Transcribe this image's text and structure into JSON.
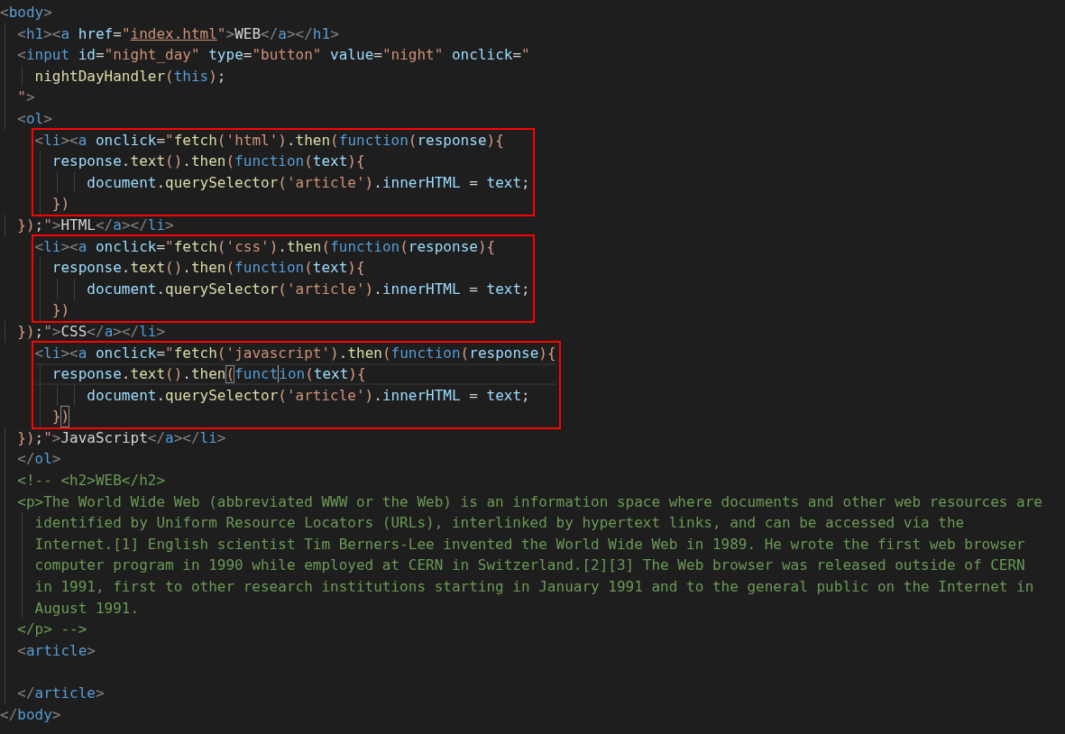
{
  "rows": [
    {
      "kind": "line",
      "current": false,
      "tokens": [
        {
          "kind": "p",
          "text": "<"
        },
        {
          "kind": "tag",
          "text": "body"
        },
        {
          "kind": "p",
          "text": ">"
        }
      ]
    },
    {
      "kind": "line",
      "current": false,
      "tokens": [
        {
          "kind": "p",
          "text": "  <"
        },
        {
          "kind": "tag",
          "text": "h1"
        },
        {
          "kind": "p",
          "text": "><"
        },
        {
          "kind": "tag",
          "text": "a"
        },
        {
          "kind": "attr",
          "text": " href"
        },
        {
          "kind": "op",
          "text": "="
        },
        {
          "kind": "str",
          "text": "\""
        },
        {
          "kind": "link",
          "text": "index.html"
        },
        {
          "kind": "str",
          "text": "\""
        },
        {
          "kind": "p",
          "text": ">"
        },
        {
          "kind": "txt",
          "text": "WEB"
        },
        {
          "kind": "p",
          "text": "</"
        },
        {
          "kind": "tag",
          "text": "a"
        },
        {
          "kind": "p",
          "text": "></"
        },
        {
          "kind": "tag",
          "text": "h1"
        },
        {
          "kind": "p",
          "text": ">"
        }
      ]
    },
    {
      "kind": "line",
      "current": false,
      "tokens": [
        {
          "kind": "p",
          "text": "  <"
        },
        {
          "kind": "tag",
          "text": "input"
        },
        {
          "kind": "attr",
          "text": " id"
        },
        {
          "kind": "op",
          "text": "="
        },
        {
          "kind": "str",
          "text": "\"night_day\""
        },
        {
          "kind": "attr",
          "text": " type"
        },
        {
          "kind": "op",
          "text": "="
        },
        {
          "kind": "str",
          "text": "\"button\""
        },
        {
          "kind": "attr",
          "text": " value"
        },
        {
          "kind": "op",
          "text": "="
        },
        {
          "kind": "str",
          "text": "\"night\""
        },
        {
          "kind": "attr",
          "text": " onclick"
        },
        {
          "kind": "op",
          "text": "="
        },
        {
          "kind": "str",
          "text": "\""
        }
      ]
    },
    {
      "kind": "line",
      "current": false,
      "tokens": [
        {
          "kind": "fn",
          "text": "    nightDayHandler"
        },
        {
          "kind": "brk",
          "text": "("
        },
        {
          "kind": "kw",
          "text": "this"
        },
        {
          "kind": "brk",
          "text": ")"
        },
        {
          "kind": "op",
          "text": ";"
        }
      ]
    },
    {
      "kind": "line",
      "current": false,
      "tokens": [
        {
          "kind": "str",
          "text": "  \""
        },
        {
          "kind": "p",
          "text": ">"
        }
      ]
    },
    {
      "kind": "line",
      "current": false,
      "tokens": [
        {
          "kind": "p",
          "text": "  <"
        },
        {
          "kind": "tag",
          "text": "ol"
        },
        {
          "kind": "p",
          "text": ">"
        }
      ]
    },
    {
      "kind": "highlight",
      "rows": [
        {
          "kind": "line",
          "current": false,
          "tokens": [
            {
              "kind": "p",
              "text": "    <"
            },
            {
              "kind": "tag",
              "text": "li"
            },
            {
              "kind": "p",
              "text": "><"
            },
            {
              "kind": "tag",
              "text": "a"
            },
            {
              "kind": "attr",
              "text": " onclick"
            },
            {
              "kind": "op",
              "text": "="
            },
            {
              "kind": "str",
              "text": "\""
            },
            {
              "kind": "fn",
              "text": "fetch"
            },
            {
              "kind": "brk",
              "text": "("
            },
            {
              "kind": "str",
              "text": "'html'"
            },
            {
              "kind": "brk",
              "text": ")"
            },
            {
              "kind": "op",
              "text": "."
            },
            {
              "kind": "fn",
              "text": "then"
            },
            {
              "kind": "brk",
              "text": "("
            },
            {
              "kind": "kw",
              "text": "function"
            },
            {
              "kind": "brk",
              "text": "("
            },
            {
              "kind": "var",
              "text": "response"
            },
            {
              "kind": "brk",
              "text": "){"
            }
          ]
        },
        {
          "kind": "line",
          "current": false,
          "tokens": [
            {
              "kind": "var",
              "text": "      response"
            },
            {
              "kind": "op",
              "text": "."
            },
            {
              "kind": "fn",
              "text": "text"
            },
            {
              "kind": "brk",
              "text": "()"
            },
            {
              "kind": "op",
              "text": "."
            },
            {
              "kind": "fn",
              "text": "then"
            },
            {
              "kind": "brk",
              "text": "("
            },
            {
              "kind": "kw",
              "text": "function"
            },
            {
              "kind": "brk",
              "text": "("
            },
            {
              "kind": "var",
              "text": "text"
            },
            {
              "kind": "brk",
              "text": "){"
            }
          ]
        },
        {
          "kind": "line",
          "current": false,
          "tokens": [
            {
              "kind": "var",
              "text": "          document"
            },
            {
              "kind": "op",
              "text": "."
            },
            {
              "kind": "fn",
              "text": "querySelector"
            },
            {
              "kind": "brk",
              "text": "("
            },
            {
              "kind": "str",
              "text": "'article'"
            },
            {
              "kind": "brk",
              "text": ")"
            },
            {
              "kind": "op",
              "text": "."
            },
            {
              "kind": "var",
              "text": "innerHTML"
            },
            {
              "kind": "op",
              "text": " = "
            },
            {
              "kind": "var",
              "text": "text"
            },
            {
              "kind": "op",
              "text": ";"
            }
          ]
        },
        {
          "kind": "line",
          "current": false,
          "tokens": [
            {
              "kind": "brk",
              "text": "      })"
            }
          ]
        }
      ]
    },
    {
      "kind": "line",
      "current": false,
      "tokens": [
        {
          "kind": "brk",
          "text": "  })"
        },
        {
          "kind": "op",
          "text": ";"
        },
        {
          "kind": "str",
          "text": "\""
        },
        {
          "kind": "p",
          "text": ">"
        },
        {
          "kind": "txt",
          "text": "HTML"
        },
        {
          "kind": "p",
          "text": "</"
        },
        {
          "kind": "tag",
          "text": "a"
        },
        {
          "kind": "p",
          "text": "></"
        },
        {
          "kind": "tag",
          "text": "li"
        },
        {
          "kind": "p",
          "text": ">"
        }
      ]
    },
    {
      "kind": "highlight",
      "rows": [
        {
          "kind": "line",
          "current": false,
          "tokens": [
            {
              "kind": "p",
              "text": "    <"
            },
            {
              "kind": "tag",
              "text": "li"
            },
            {
              "kind": "p",
              "text": "><"
            },
            {
              "kind": "tag",
              "text": "a"
            },
            {
              "kind": "attr",
              "text": " onclick"
            },
            {
              "kind": "op",
              "text": "="
            },
            {
              "kind": "str",
              "text": "\""
            },
            {
              "kind": "fn",
              "text": "fetch"
            },
            {
              "kind": "brk",
              "text": "("
            },
            {
              "kind": "str",
              "text": "'css'"
            },
            {
              "kind": "brk",
              "text": ")"
            },
            {
              "kind": "op",
              "text": "."
            },
            {
              "kind": "fn",
              "text": "then"
            },
            {
              "kind": "brk",
              "text": "("
            },
            {
              "kind": "kw",
              "text": "function"
            },
            {
              "kind": "brk",
              "text": "("
            },
            {
              "kind": "var",
              "text": "response"
            },
            {
              "kind": "brk",
              "text": "){"
            }
          ]
        },
        {
          "kind": "line",
          "current": false,
          "tokens": [
            {
              "kind": "var",
              "text": "      response"
            },
            {
              "kind": "op",
              "text": "."
            },
            {
              "kind": "fn",
              "text": "text"
            },
            {
              "kind": "brk",
              "text": "()"
            },
            {
              "kind": "op",
              "text": "."
            },
            {
              "kind": "fn",
              "text": "then"
            },
            {
              "kind": "brk",
              "text": "("
            },
            {
              "kind": "kw",
              "text": "function"
            },
            {
              "kind": "brk",
              "text": "("
            },
            {
              "kind": "var",
              "text": "text"
            },
            {
              "kind": "brk",
              "text": "){"
            }
          ]
        },
        {
          "kind": "line",
          "current": false,
          "tokens": [
            {
              "kind": "var",
              "text": "          document"
            },
            {
              "kind": "op",
              "text": "."
            },
            {
              "kind": "fn",
              "text": "querySelector"
            },
            {
              "kind": "brk",
              "text": "("
            },
            {
              "kind": "str",
              "text": "'article'"
            },
            {
              "kind": "brk",
              "text": ")"
            },
            {
              "kind": "op",
              "text": "."
            },
            {
              "kind": "var",
              "text": "innerHTML"
            },
            {
              "kind": "op",
              "text": " = "
            },
            {
              "kind": "var",
              "text": "text"
            },
            {
              "kind": "op",
              "text": ";"
            }
          ]
        },
        {
          "kind": "line",
          "current": false,
          "tokens": [
            {
              "kind": "brk",
              "text": "      })"
            }
          ]
        }
      ]
    },
    {
      "kind": "line",
      "current": false,
      "tokens": [
        {
          "kind": "brk",
          "text": "  })"
        },
        {
          "kind": "op",
          "text": ";"
        },
        {
          "kind": "str",
          "text": "\""
        },
        {
          "kind": "p",
          "text": ">"
        },
        {
          "kind": "txt",
          "text": "CSS"
        },
        {
          "kind": "p",
          "text": "</"
        },
        {
          "kind": "tag",
          "text": "a"
        },
        {
          "kind": "p",
          "text": "></"
        },
        {
          "kind": "tag",
          "text": "li"
        },
        {
          "kind": "p",
          "text": ">"
        }
      ]
    },
    {
      "kind": "highlight",
      "rows": [
        {
          "kind": "line",
          "current": false,
          "tokens": [
            {
              "kind": "p",
              "text": "    <"
            },
            {
              "kind": "tag",
              "text": "li"
            },
            {
              "kind": "p",
              "text": "><"
            },
            {
              "kind": "tag",
              "text": "a"
            },
            {
              "kind": "attr",
              "text": " onclick"
            },
            {
              "kind": "op",
              "text": "="
            },
            {
              "kind": "str",
              "text": "\""
            },
            {
              "kind": "fn",
              "text": "fetch"
            },
            {
              "kind": "brk",
              "text": "("
            },
            {
              "kind": "str",
              "text": "'javascript'"
            },
            {
              "kind": "brk",
              "text": ")"
            },
            {
              "kind": "op",
              "text": "."
            },
            {
              "kind": "fn",
              "text": "then"
            },
            {
              "kind": "brk",
              "text": "("
            },
            {
              "kind": "kw",
              "text": "function"
            },
            {
              "kind": "brk",
              "text": "("
            },
            {
              "kind": "var",
              "text": "response"
            },
            {
              "kind": "brk",
              "text": "){"
            }
          ]
        },
        {
          "kind": "line",
          "current": true,
          "tokens": [
            {
              "kind": "var",
              "text": "      response"
            },
            {
              "kind": "op",
              "text": "."
            },
            {
              "kind": "fn",
              "text": "text"
            },
            {
              "kind": "brk",
              "text": "()"
            },
            {
              "kind": "op",
              "text": "."
            },
            {
              "kind": "fn",
              "text": "then"
            },
            {
              "kind": "match",
              "text": "("
            },
            {
              "kind": "kw",
              "text": "funct"
            },
            {
              "kind": "caret"
            },
            {
              "kind": "kw",
              "text": "ion"
            },
            {
              "kind": "brk",
              "text": "("
            },
            {
              "kind": "var",
              "text": "text"
            },
            {
              "kind": "brk",
              "text": "){"
            }
          ]
        },
        {
          "kind": "line",
          "current": false,
          "tokens": [
            {
              "kind": "var",
              "text": "          document"
            },
            {
              "kind": "op",
              "text": "."
            },
            {
              "kind": "fn",
              "text": "querySelector"
            },
            {
              "kind": "brk",
              "text": "("
            },
            {
              "kind": "str",
              "text": "'article'"
            },
            {
              "kind": "brk",
              "text": ")"
            },
            {
              "kind": "op",
              "text": "."
            },
            {
              "kind": "var",
              "text": "innerHTML"
            },
            {
              "kind": "op",
              "text": " = "
            },
            {
              "kind": "var",
              "text": "text"
            },
            {
              "kind": "op",
              "text": ";"
            }
          ]
        },
        {
          "kind": "line",
          "current": false,
          "tokens": [
            {
              "kind": "brk",
              "text": "      }"
            },
            {
              "kind": "match",
              "text": ")"
            }
          ]
        }
      ]
    },
    {
      "kind": "line",
      "current": false,
      "tokens": [
        {
          "kind": "brk",
          "text": "  })"
        },
        {
          "kind": "op",
          "text": ";"
        },
        {
          "kind": "str",
          "text": "\""
        },
        {
          "kind": "p",
          "text": ">"
        },
        {
          "kind": "txt",
          "text": "JavaScript"
        },
        {
          "kind": "p",
          "text": "</"
        },
        {
          "kind": "tag",
          "text": "a"
        },
        {
          "kind": "p",
          "text": "></"
        },
        {
          "kind": "tag",
          "text": "li"
        },
        {
          "kind": "p",
          "text": ">"
        }
      ]
    },
    {
      "kind": "line",
      "current": false,
      "tokens": [
        {
          "kind": "p",
          "text": "  </"
        },
        {
          "kind": "tag",
          "text": "ol"
        },
        {
          "kind": "p",
          "text": ">"
        }
      ]
    },
    {
      "kind": "line",
      "current": false,
      "tokens": [
        {
          "kind": "cm",
          "text": "  <!-- <h2>WEB</h2>"
        }
      ]
    },
    {
      "kind": "line",
      "current": false,
      "tokens": [
        {
          "kind": "cm",
          "text": "  <p>The World Wide Web (abbreviated WWW or the Web) is an information space where documents and other web resources are"
        }
      ]
    },
    {
      "kind": "line",
      "current": false,
      "tokens": [
        {
          "kind": "cm",
          "text": "    identified by Uniform Resource Locators (URLs), interlinked by hypertext links, and can be accessed via the"
        }
      ]
    },
    {
      "kind": "line",
      "current": false,
      "tokens": [
        {
          "kind": "cm",
          "text": "    Internet.[1] English scientist Tim Berners-Lee invented the World Wide Web in 1989. He wrote the first web browser"
        }
      ]
    },
    {
      "kind": "line",
      "current": false,
      "tokens": [
        {
          "kind": "cm",
          "text": "    computer program in 1990 while employed at CERN in Switzerland.[2][3] The Web browser was released outside of CERN"
        }
      ]
    },
    {
      "kind": "line",
      "current": false,
      "tokens": [
        {
          "kind": "cm",
          "text": "    in 1991, first to other research institutions starting in January 1991 and to the general public on the Internet in"
        }
      ]
    },
    {
      "kind": "line",
      "current": false,
      "tokens": [
        {
          "kind": "cm",
          "text": "    August 1991."
        }
      ]
    },
    {
      "kind": "line",
      "current": false,
      "tokens": [
        {
          "kind": "cm",
          "text": "  </p> -->"
        }
      ]
    },
    {
      "kind": "line",
      "current": false,
      "tokens": [
        {
          "kind": "p",
          "text": "  <"
        },
        {
          "kind": "tag",
          "text": "article"
        },
        {
          "kind": "p",
          "text": ">"
        }
      ]
    },
    {
      "kind": "blank"
    },
    {
      "kind": "line",
      "current": false,
      "tokens": [
        {
          "kind": "p",
          "text": "  </"
        },
        {
          "kind": "tag",
          "text": "article"
        },
        {
          "kind": "p",
          "text": ">"
        }
      ]
    },
    {
      "kind": "line",
      "current": false,
      "tokens": [
        {
          "kind": "p",
          "text": "</"
        },
        {
          "kind": "tag",
          "text": "body"
        },
        {
          "kind": "p",
          "text": ">"
        }
      ]
    }
  ]
}
